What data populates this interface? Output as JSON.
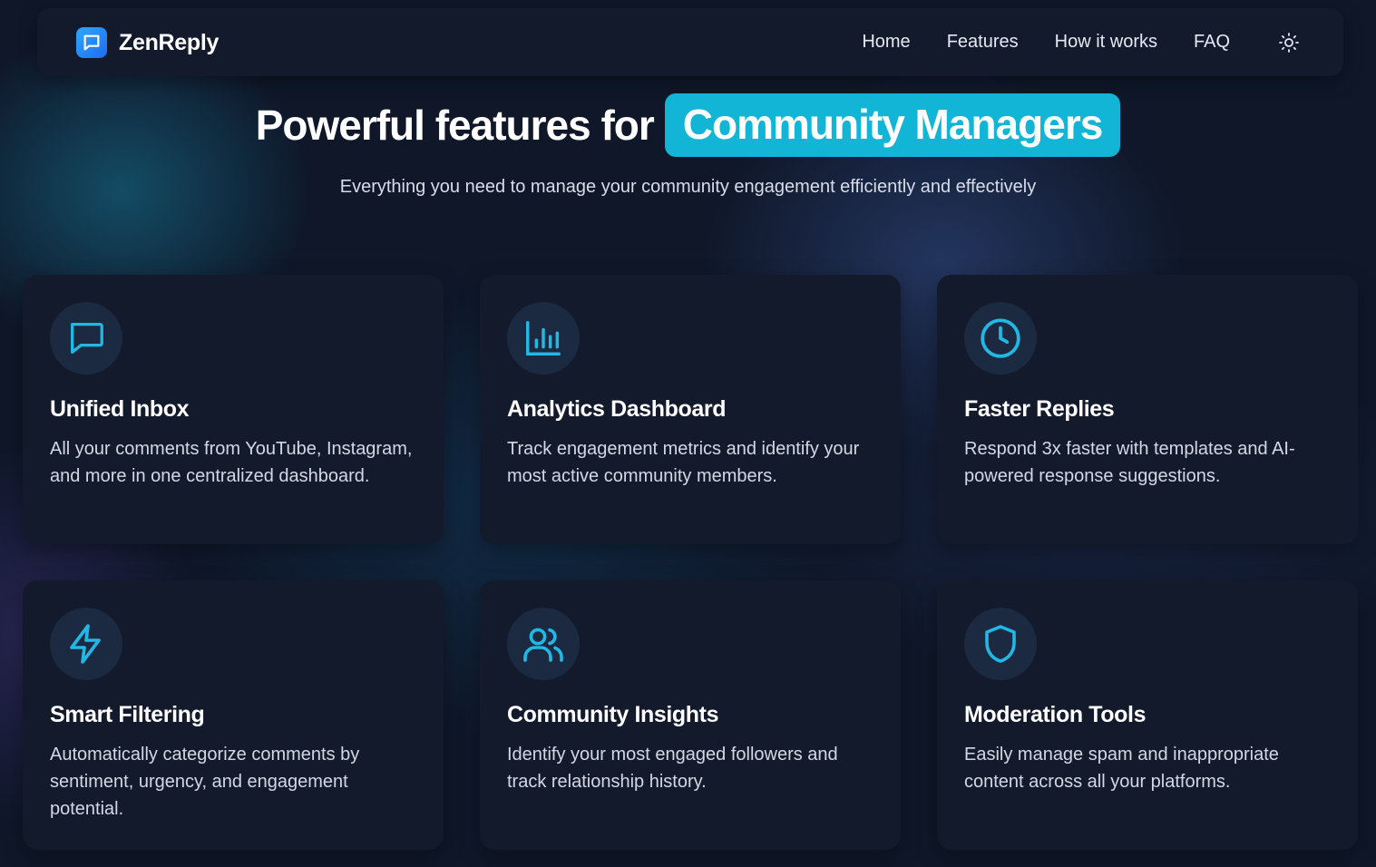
{
  "brand": {
    "name": "ZenReply",
    "logo_icon": "chat-bubble-icon"
  },
  "nav": {
    "links": [
      "Home",
      "Features",
      "How it works",
      "FAQ"
    ],
    "theme_toggle_icon": "sun-icon"
  },
  "hero": {
    "title_prefix": "Powerful features for",
    "title_highlight": "Community Managers",
    "subtitle": "Everything you need to manage your community engagement efficiently and effectively"
  },
  "features": [
    {
      "icon": "chat-bubble-icon",
      "title": "Unified Inbox",
      "description": "All your comments from YouTube, Instagram, and more in one centralized dashboard."
    },
    {
      "icon": "bar-chart-icon",
      "title": "Analytics Dashboard",
      "description": "Track engagement metrics and identify your most active community members."
    },
    {
      "icon": "clock-icon",
      "title": "Faster Replies",
      "description": "Respond 3x faster with templates and AI-powered response suggestions."
    },
    {
      "icon": "lightning-icon",
      "title": "Smart Filtering",
      "description": "Automatically categorize comments by sentiment, urgency, and engagement potential."
    },
    {
      "icon": "users-icon",
      "title": "Community Insights",
      "description": "Identify your most engaged followers and track relationship history."
    },
    {
      "icon": "shield-icon",
      "title": "Moderation Tools",
      "description": "Easily manage spam and inappropriate content across all your platforms."
    }
  ],
  "colors": {
    "accent": "#12b5d6",
    "icon_stroke": "#22b8e6",
    "card_bg": "#121a2c",
    "page_bg": "#0f1729"
  }
}
